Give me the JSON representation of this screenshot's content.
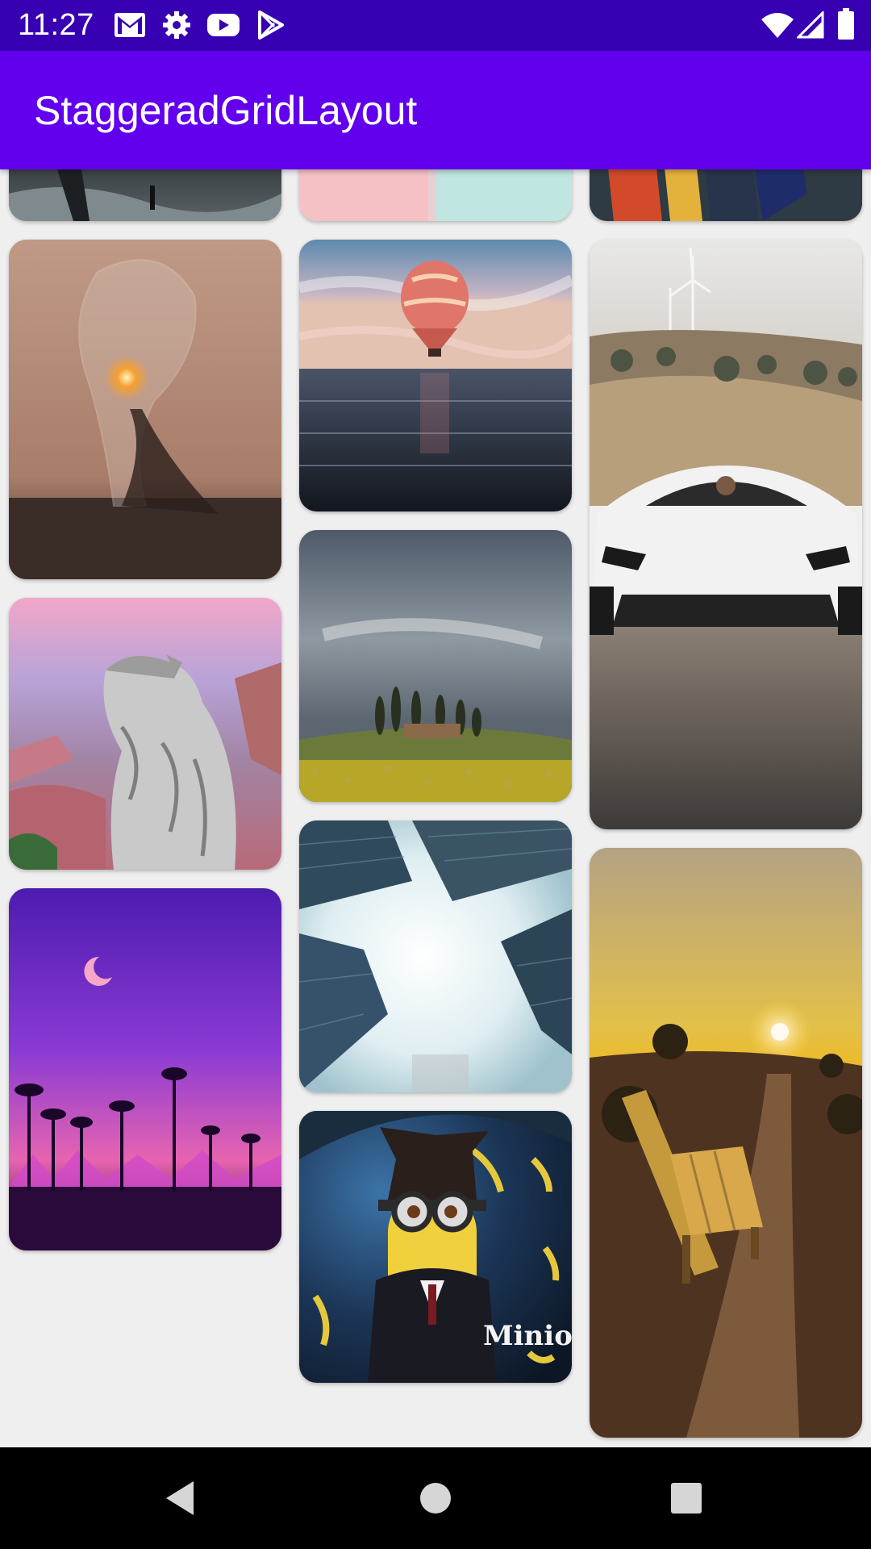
{
  "status_bar": {
    "time": "11:27",
    "icons_left": [
      "gmail-icon",
      "settings-icon",
      "youtube-icon",
      "play-store-icon"
    ],
    "icons_right": [
      "wifi-icon",
      "signal-icon",
      "battery-icon"
    ]
  },
  "app_bar": {
    "title": "StaggeradGridLayout",
    "color": "#6200ee",
    "status_color": "#3700b3"
  },
  "grid": {
    "columns": 3,
    "items": [
      {
        "name": "waterfall-night"
      },
      {
        "name": "pastel-wall"
      },
      {
        "name": "colorful-figure"
      },
      {
        "name": "water-lightbulb"
      },
      {
        "name": "hot-air-balloon-sea"
      },
      {
        "name": "white-sports-car"
      },
      {
        "name": "cat-canyon"
      },
      {
        "name": "cloudy-field-cypress"
      },
      {
        "name": "sunset-bench"
      },
      {
        "name": "purple-palm-sunset"
      },
      {
        "name": "skyscrapers-looking-up"
      },
      {
        "name": "minion-umbrella",
        "caption": "Minion"
      }
    ]
  },
  "nav_bar": {
    "buttons": [
      "back-icon",
      "home-icon",
      "recents-icon"
    ]
  }
}
